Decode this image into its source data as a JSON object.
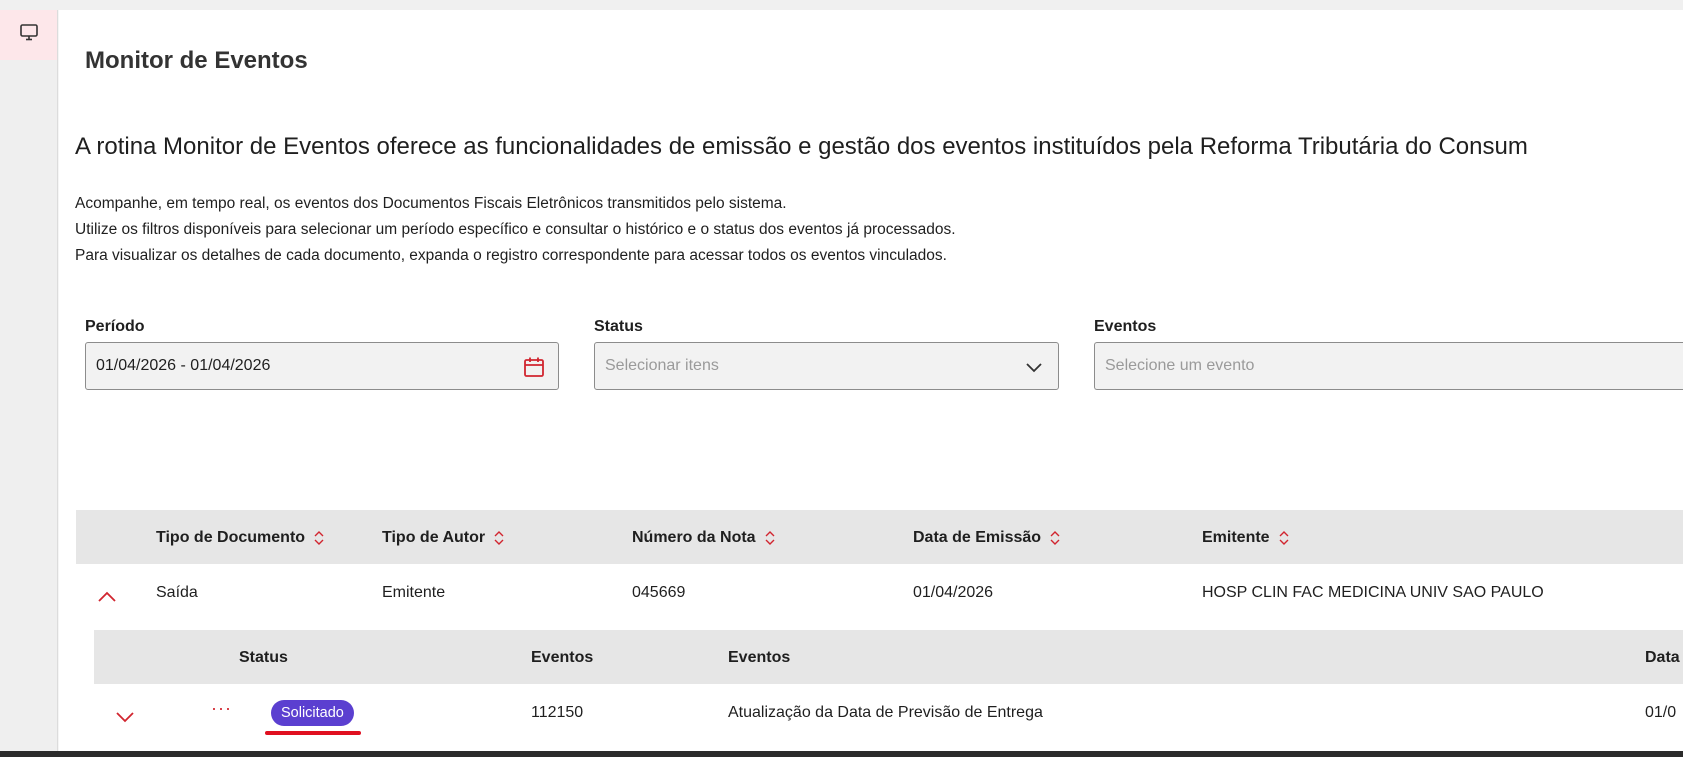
{
  "sidebar": {
    "active_icon": "monitor-icon"
  },
  "page": {
    "title": "Monitor de Eventos",
    "intro": "A rotina Monitor de Eventos oferece as funcionalidades de emissão e gestão dos eventos instituídos pela Reforma Tributária do Consum",
    "desc": [
      "Acompanhe, em tempo real, os eventos dos Documentos Fiscais Eletrônicos transmitidos pelo sistema.",
      "Utilize os filtros disponíveis para selecionar um período específico e consultar o histórico e o status dos eventos já processados.",
      "Para visualizar os detalhes de cada documento, expanda o registro correspondente para acessar todos os eventos vinculados."
    ]
  },
  "filters": {
    "periodo": {
      "label": "Período",
      "value": "01/04/2026  - 01/04/2026"
    },
    "status": {
      "label": "Status",
      "placeholder": "Selecionar itens"
    },
    "eventos": {
      "label": "Eventos",
      "placeholder": "Selecione um evento"
    }
  },
  "table": {
    "columns": [
      "Tipo de Documento",
      "Tipo de Autor",
      "Número da Nota",
      "Data de Emissão",
      "Emitente"
    ],
    "rows": [
      {
        "tipo_documento": "Saída",
        "tipo_autor": "Emitente",
        "numero_nota": "045669",
        "data_emissao": "01/04/2026",
        "emitente": "HOSP CLIN FAC MEDICINA UNIV SAO PAULO"
      }
    ]
  },
  "subtable": {
    "columns": [
      "Status",
      "Eventos",
      "Eventos",
      "Data"
    ],
    "rows": [
      {
        "more": "···",
        "status": "Solicitado",
        "codigo": "112150",
        "evento": "Atualização da Data de Previsão de Entrega",
        "data": "01/0"
      }
    ]
  },
  "colors": {
    "accent": "#d1252f",
    "badge": "#5b3fd0",
    "underline": "#e01020"
  }
}
